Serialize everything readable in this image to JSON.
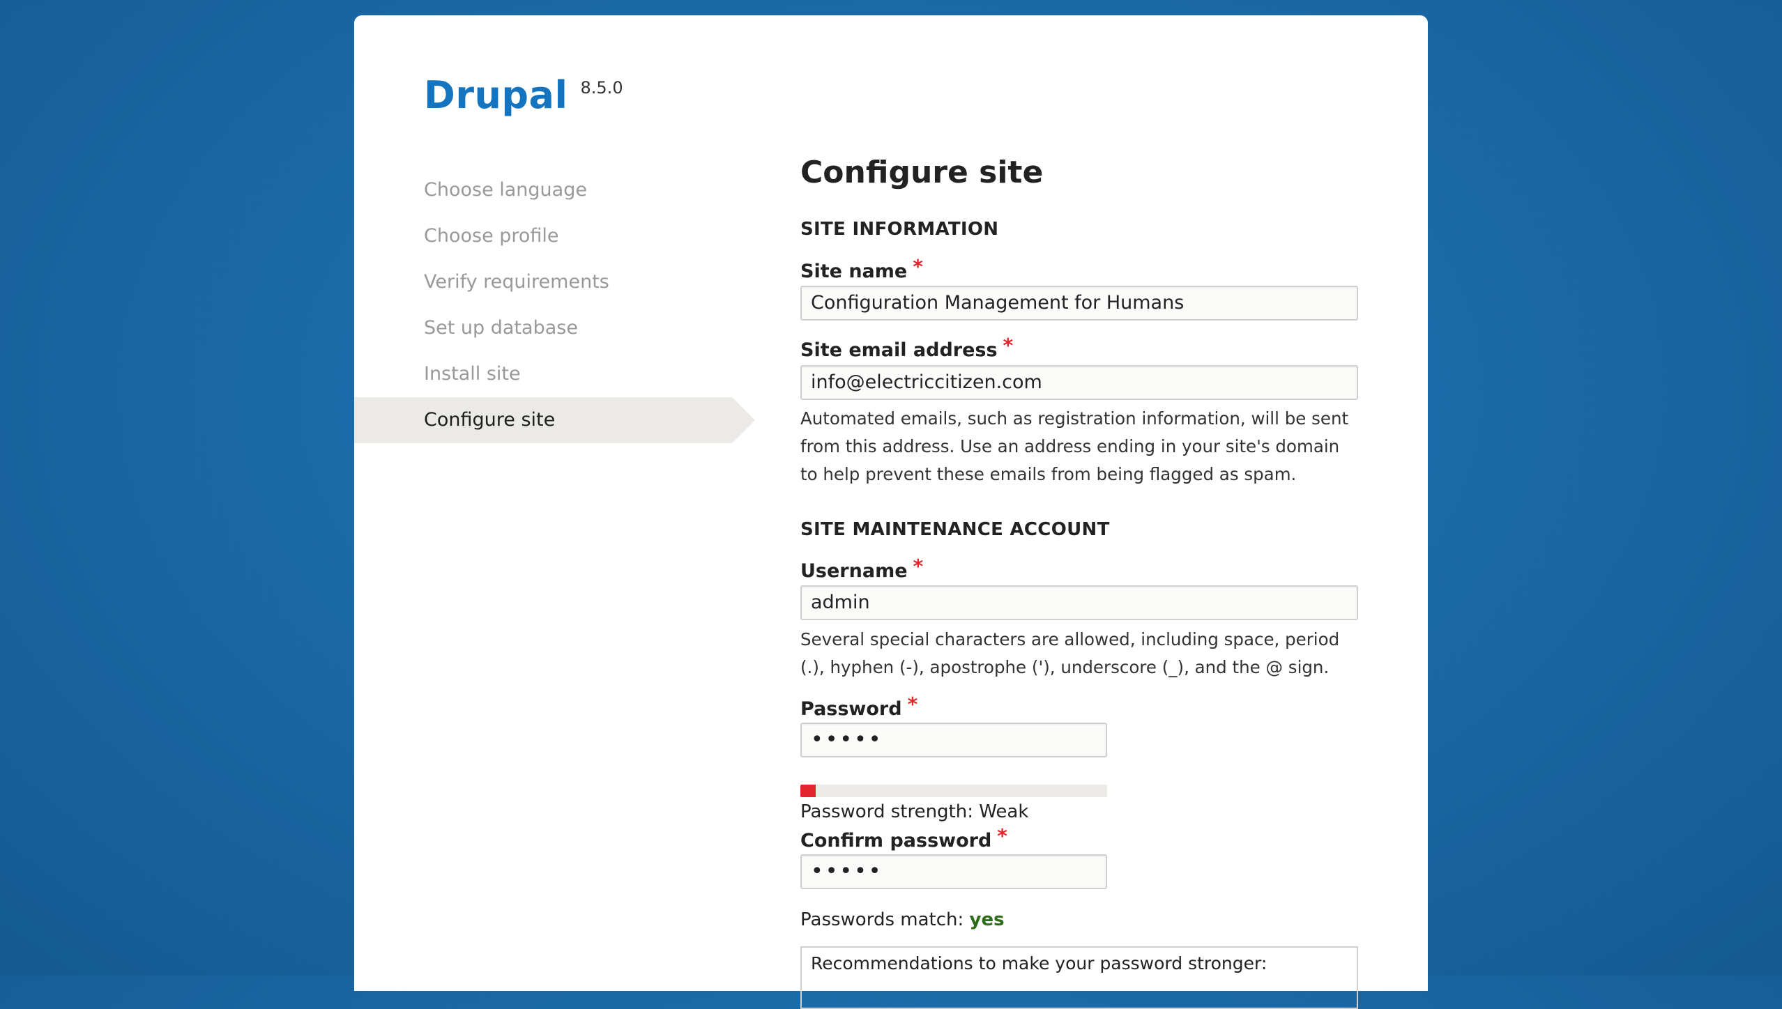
{
  "brand": {
    "name": "Drupal",
    "version": "8.5.0"
  },
  "steps": [
    {
      "label": "Choose language",
      "active": false
    },
    {
      "label": "Choose profile",
      "active": false
    },
    {
      "label": "Verify requirements",
      "active": false
    },
    {
      "label": "Set up database",
      "active": false
    },
    {
      "label": "Install site",
      "active": false
    },
    {
      "label": "Configure site",
      "active": true
    }
  ],
  "page": {
    "title": "Configure site"
  },
  "site_information": {
    "heading": "SITE INFORMATION",
    "site_name": {
      "label": "Site name",
      "required_mark": "*",
      "value": "Configuration Management for Humans"
    },
    "site_email": {
      "label": "Site email address",
      "required_mark": "*",
      "value": "info@electriccitizen.com",
      "description": "Automated emails, such as registration information, will be sent from this address. Use an address ending in your site's domain to help prevent these emails from being flagged as spam."
    }
  },
  "maintenance_account": {
    "heading": "SITE MAINTENANCE ACCOUNT",
    "username": {
      "label": "Username",
      "required_mark": "*",
      "value": "admin",
      "description": "Several special characters are allowed, including space, period (.), hyphen (-), apostrophe ('), underscore (_), and the @ sign."
    },
    "password": {
      "label": "Password",
      "required_mark": "*",
      "masked_value": "•••••",
      "strength_label": "Password strength:",
      "strength_value": "Weak",
      "strength_fraction": 0.05,
      "strength_color": "#e0262c"
    },
    "confirm_password": {
      "label": "Confirm password",
      "required_mark": "*",
      "masked_value": "•••••",
      "match_label": "Passwords match:",
      "match_value": "yes"
    },
    "recommendations_title": "Recommendations to make your password stronger:"
  },
  "colors": {
    "brand_blue": "#1574c0",
    "background_blue": "#1a6aa8",
    "required_red": "#e0262c",
    "match_green": "#2e6b1a",
    "active_step_bg": "#ebeae6"
  }
}
